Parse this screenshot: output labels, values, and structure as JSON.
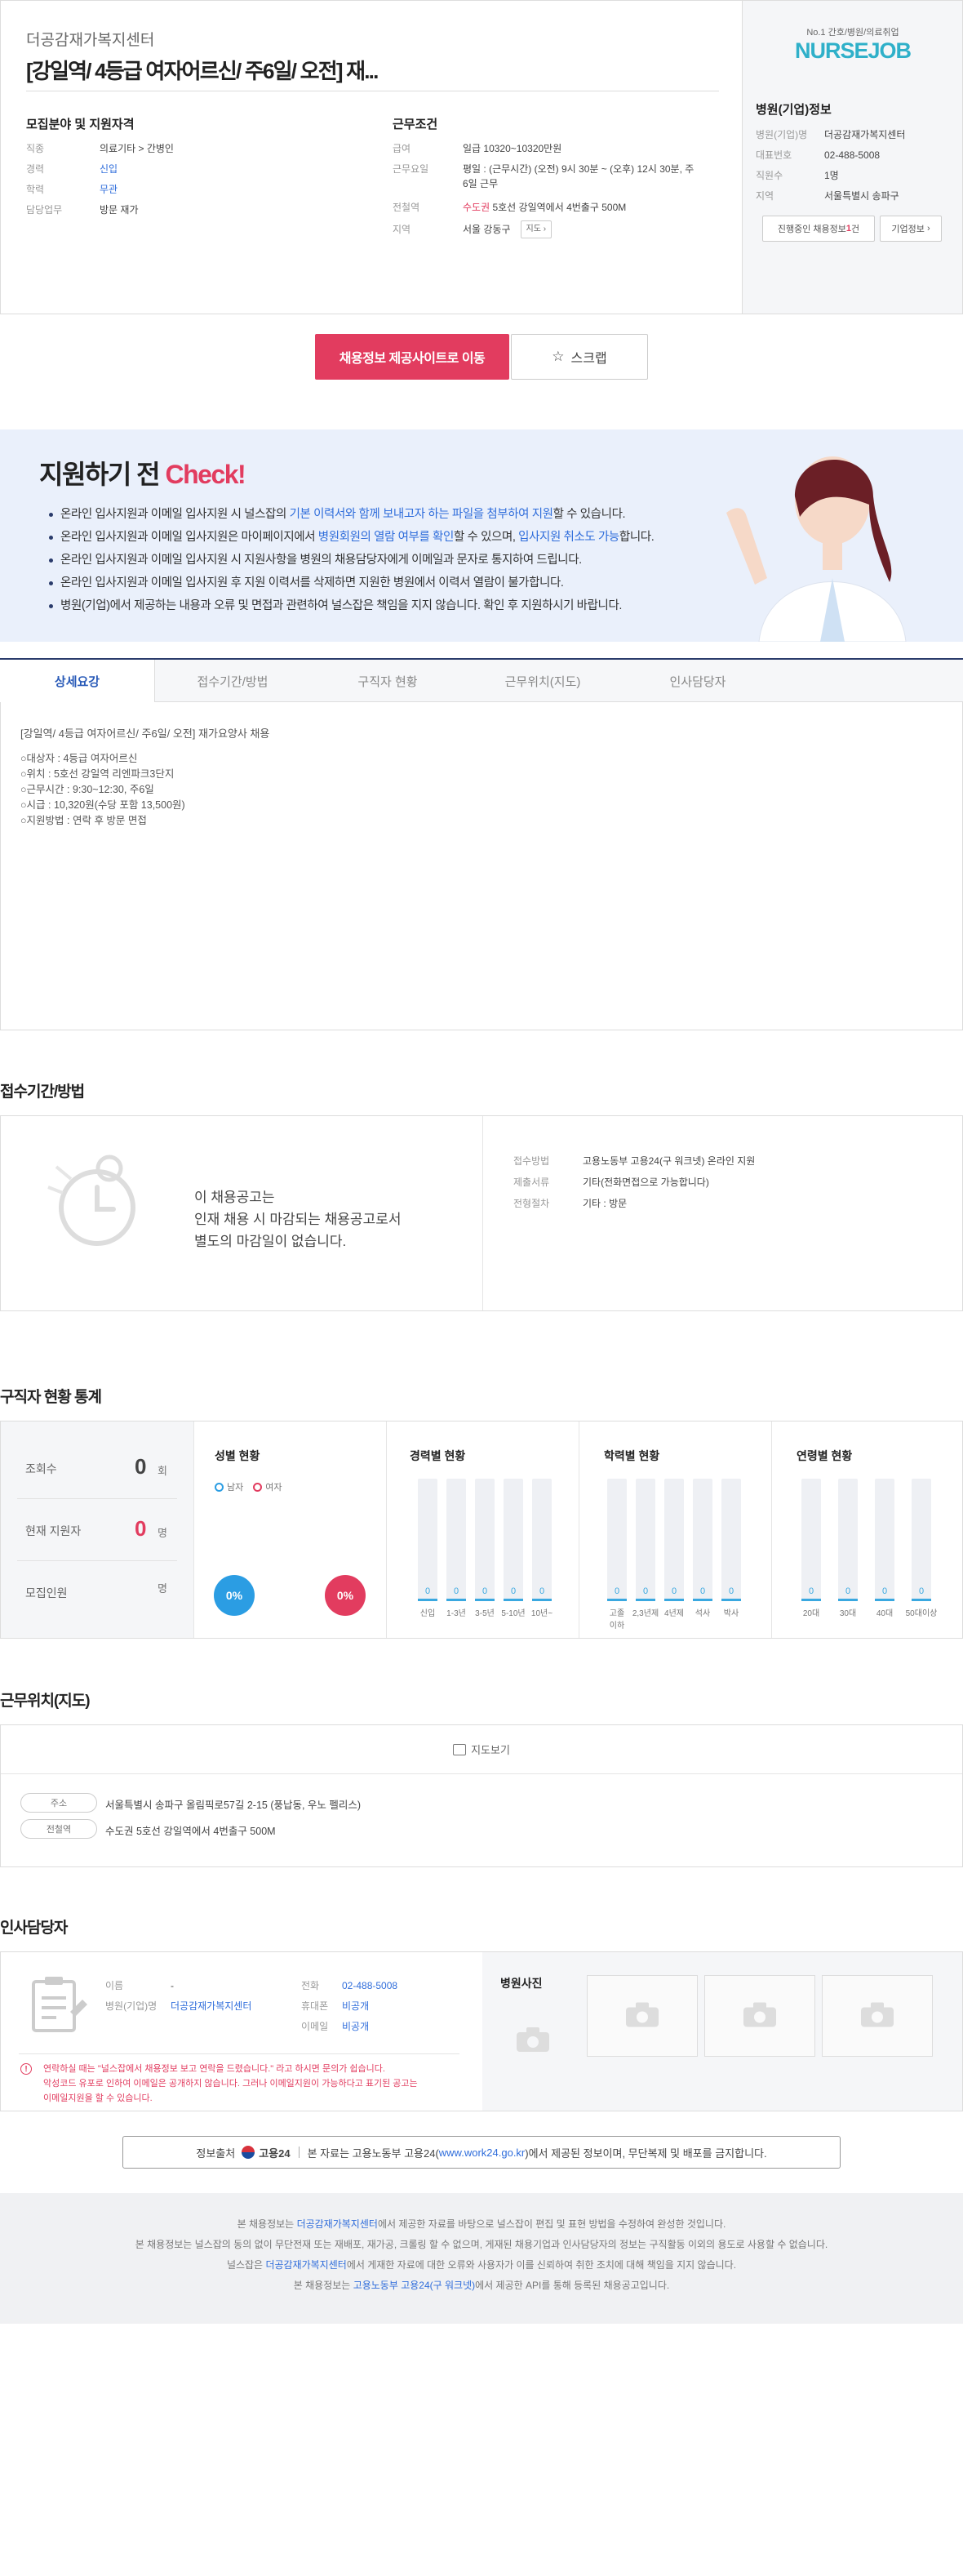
{
  "header": {
    "company": "더공감재가복지센터",
    "title": "[강일역/ 4등급 여자어르신/ 주6일/ 오전] 재...",
    "recruit_heading": "모집분야 및 지원자격",
    "recruit": [
      {
        "label": "직종",
        "value": "의료기타 > 간병인"
      },
      {
        "label": "경력",
        "value": "신입"
      },
      {
        "label": "학력",
        "value": "무관"
      },
      {
        "label": "담당업무",
        "value": "방문 재가"
      }
    ],
    "work_heading": "근무조건",
    "work": {
      "pay_label": "급여",
      "pay": "일급 10320~10320만원",
      "days_label": "근무요일",
      "days_1": "평일 : (근무시간) (오전) 9시 30분 ~ (오후) 12시 30분, 주",
      "days_2": "6일 근무",
      "station_label": "전철역",
      "station_line": "수도권",
      "station_rest": "5호선 강일역에서 4번출구 500M",
      "area_label": "지역",
      "area": "서울 강동구",
      "map_btn": "지도"
    }
  },
  "side": {
    "tagline": "No.1 간호/병원/의료취업",
    "logo": "NURSEJOB",
    "heading": "병원(기업)정보",
    "info": [
      {
        "label": "병원(기업)명",
        "value": "더공감재가복지센터"
      },
      {
        "label": "대표번호",
        "value": "02-488-5008"
      },
      {
        "label": "직원수",
        "value": "1명"
      },
      {
        "label": "지역",
        "value": "서울특별시 송파구"
      }
    ],
    "btn_jobs_pre": "진행중인 채용정보 ",
    "btn_jobs_count": "1",
    "btn_jobs_post": "건",
    "btn_company": "기업정보"
  },
  "actions": {
    "apply": "채용정보 제공사이트로 이동",
    "scrap": "스크랩"
  },
  "check": {
    "title_pre": "지원하기 전 ",
    "title_em": "Check!",
    "items": [
      [
        "온라인 입사지원과 이메일 입사지원 시 널스잡의 ",
        "기본 이력서와 함께 보내고자 하는 파일을 첨부하여 지원",
        "할 수 있습니다."
      ],
      [
        "온라인 입사지원과 이메일 입사지원은 마이페이지에서 ",
        "병원회원의 열람 여부를 확인",
        "할 수 있으며, ",
        "입사지원 취소도 가능",
        "합니다."
      ],
      [
        "온라인 입사지원과 이메일 입사지원 시 지원사항을 병원의 채용담당자에게 이메일과 문자로 통지하여 드립니다."
      ],
      [
        "온라인 입사지원과 이메일 입사지원 후 지원 이력서를 삭제하면 지원한 병원에서 이력서 열람이 불가합니다."
      ],
      [
        "병원(기업)에서 제공하는 내용과 오류 및 면접과 관련하여 널스잡은 책임을 지지 않습니다. 확인 후 지원하시기 바랍니다."
      ]
    ]
  },
  "tabs": [
    "상세요강",
    "접수기간/방법",
    "구직자 현황",
    "근무위치(지도)",
    "인사담당자"
  ],
  "detail": {
    "title": "[강일역/ 4등급 여자어르신/ 주6일/ 오전] 재가요양사 채용",
    "lines": [
      "○대상자 : 4등급 여자어르신",
      "○위치 : 5호선 강일역 리엔파크3단지",
      "○근무시간 : 9:30~12:30, 주6일",
      "○시급 : 10,320원(수당 포함 13,500원)",
      "○지원방법 : 연락 후 방문 면접"
    ]
  },
  "period": {
    "heading": "접수기간/방법",
    "msg": [
      "이 채용공고는",
      "인재 채용 시 마감되는 채용공고로서",
      "별도의 마감일이 없습니다."
    ],
    "rows": [
      {
        "label": "접수방법",
        "value": "고용노동부 고용24(구 워크넷) 온라인 지원"
      },
      {
        "label": "제출서류",
        "value": "기타(전화면접으로 가능합니다)"
      },
      {
        "label": "전형절차",
        "value": "기타 : 방문"
      }
    ]
  },
  "stats": {
    "heading": "구직자 현황 통계",
    "views_label": "조회수",
    "views": "0",
    "views_unit": "회",
    "applicants_label": "현재 지원자",
    "applicants": "0",
    "applicants_unit": "명",
    "recruit_label": "모집인원",
    "recruit_unit": "명",
    "gender_title": "성별 현황",
    "male": "남자",
    "female": "여자",
    "male_pct": "0%",
    "female_pct": "0%",
    "career_title": "경력별 현황",
    "career": [
      {
        "label": "신입",
        "value": 0
      },
      {
        "label": "1-3년",
        "value": 0
      },
      {
        "label": "3-5년",
        "value": 0
      },
      {
        "label": "5-10년",
        "value": 0
      },
      {
        "label": "10년~",
        "value": 0
      }
    ],
    "edu_title": "학력별 현황",
    "edu": [
      {
        "label": "고졸\n이하",
        "value": 0
      },
      {
        "label": "2,3년제",
        "value": 0
      },
      {
        "label": "4년제",
        "value": 0
      },
      {
        "label": "석사",
        "value": 0
      },
      {
        "label": "박사",
        "value": 0
      }
    ],
    "age_title": "연령별 현황",
    "age": [
      {
        "label": "20대",
        "value": 0
      },
      {
        "label": "30대",
        "value": 0
      },
      {
        "label": "40대",
        "value": 0
      },
      {
        "label": "50대이상",
        "value": 0
      }
    ]
  },
  "location": {
    "heading": "근무위치(지도)",
    "map_btn": "지도보기",
    "addr_label": "주소",
    "addr": "서울특별시 송파구 올림픽로57길 2-15 (풍납동, 우노 펠리스)",
    "station_label": "전철역",
    "station": "수도권 5호선 강일역에서 4번출구 500M"
  },
  "manager": {
    "heading": "인사담당자",
    "name_label": "이름",
    "name": "-",
    "company_label": "병원(기업)명",
    "company": "더공감재가복지센터",
    "phone_label": "전화",
    "phone": "02-488-5008",
    "mobile_label": "휴대폰",
    "mobile": "비공개",
    "email_label": "이메일",
    "email": "비공개",
    "warn1": "연락하실 때는 \"널스잡에서 채용정보 보고 연락을 드렸습니다.\" 라고 하시면 문의가 쉽습니다.",
    "warn2": "악성코드 유포로 인하여 이메일은 공개하지 않습니다. 그러나 이메일지원이 가능하다고 표기된 공고는",
    "warn3": "이메일지원을 할 수 있습니다.",
    "photo_heading": "병원사진"
  },
  "source": {
    "pre": "정보출처",
    "brand": "고용24",
    "text_pre": "본 자료는 고용노동부 고용24(",
    "link": "www.work24.go.kr",
    "text_post": ")에서 제공된 정보이며, 무단복제 및 배포를 금지합니다."
  },
  "footer": [
    [
      "본 채용정보는 ",
      "더공감재가복지센터",
      "에서 제공한 자료를 바탕으로 널스잡이 편집 및 표현 방법을 수정하여 완성한 것입니다."
    ],
    [
      "본 채용정보는 널스잡의 동의 없이 무단전재 또는 재배포, 재가공, 크롤링 할 수 없으며, 게재된 채용기업과 인사담당자의 정보는 구직활동 이외의 용도로 사용할 수 없습니다."
    ],
    [
      "널스잡은 ",
      "더공감재가복지센터",
      "에서 게재한 자료에 대한 오류와 사용자가 이를 신뢰하여 취한 조치에 대해 책임을 지지 않습니다."
    ],
    [
      "본 채용정보는 ",
      "고용노동부 고용24(구 워크넷)",
      "에서 제공한 API를 통해 등록된 채용공고입니다."
    ]
  ],
  "colors": {
    "accent": "#e23c5f",
    "blue": "#2f6ddb",
    "navy": "#2a3b6b"
  }
}
